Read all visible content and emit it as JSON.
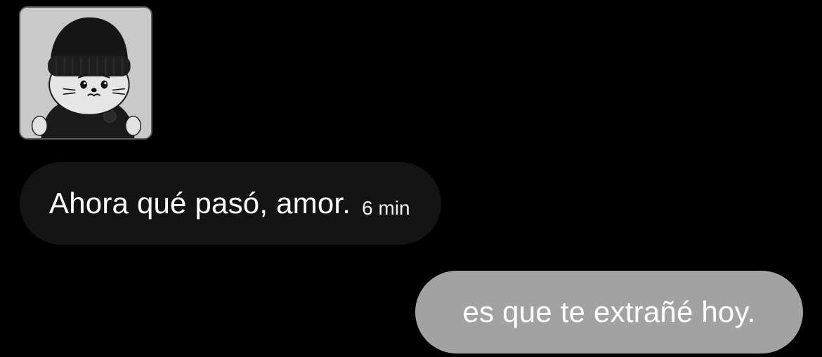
{
  "contact": {
    "avatar_icon": "cartoon-seal-with-beanie-avatar"
  },
  "messages": [
    {
      "direction": "received",
      "text": "Ahora qué pasó, amor.",
      "time": "6 min",
      "bubble_color": "#141414"
    },
    {
      "direction": "sent",
      "text": "es que te extrañé hoy.",
      "bubble_color": "#a2a2a2"
    }
  ],
  "colors": {
    "background": "#000000",
    "text": "#ffffff"
  }
}
